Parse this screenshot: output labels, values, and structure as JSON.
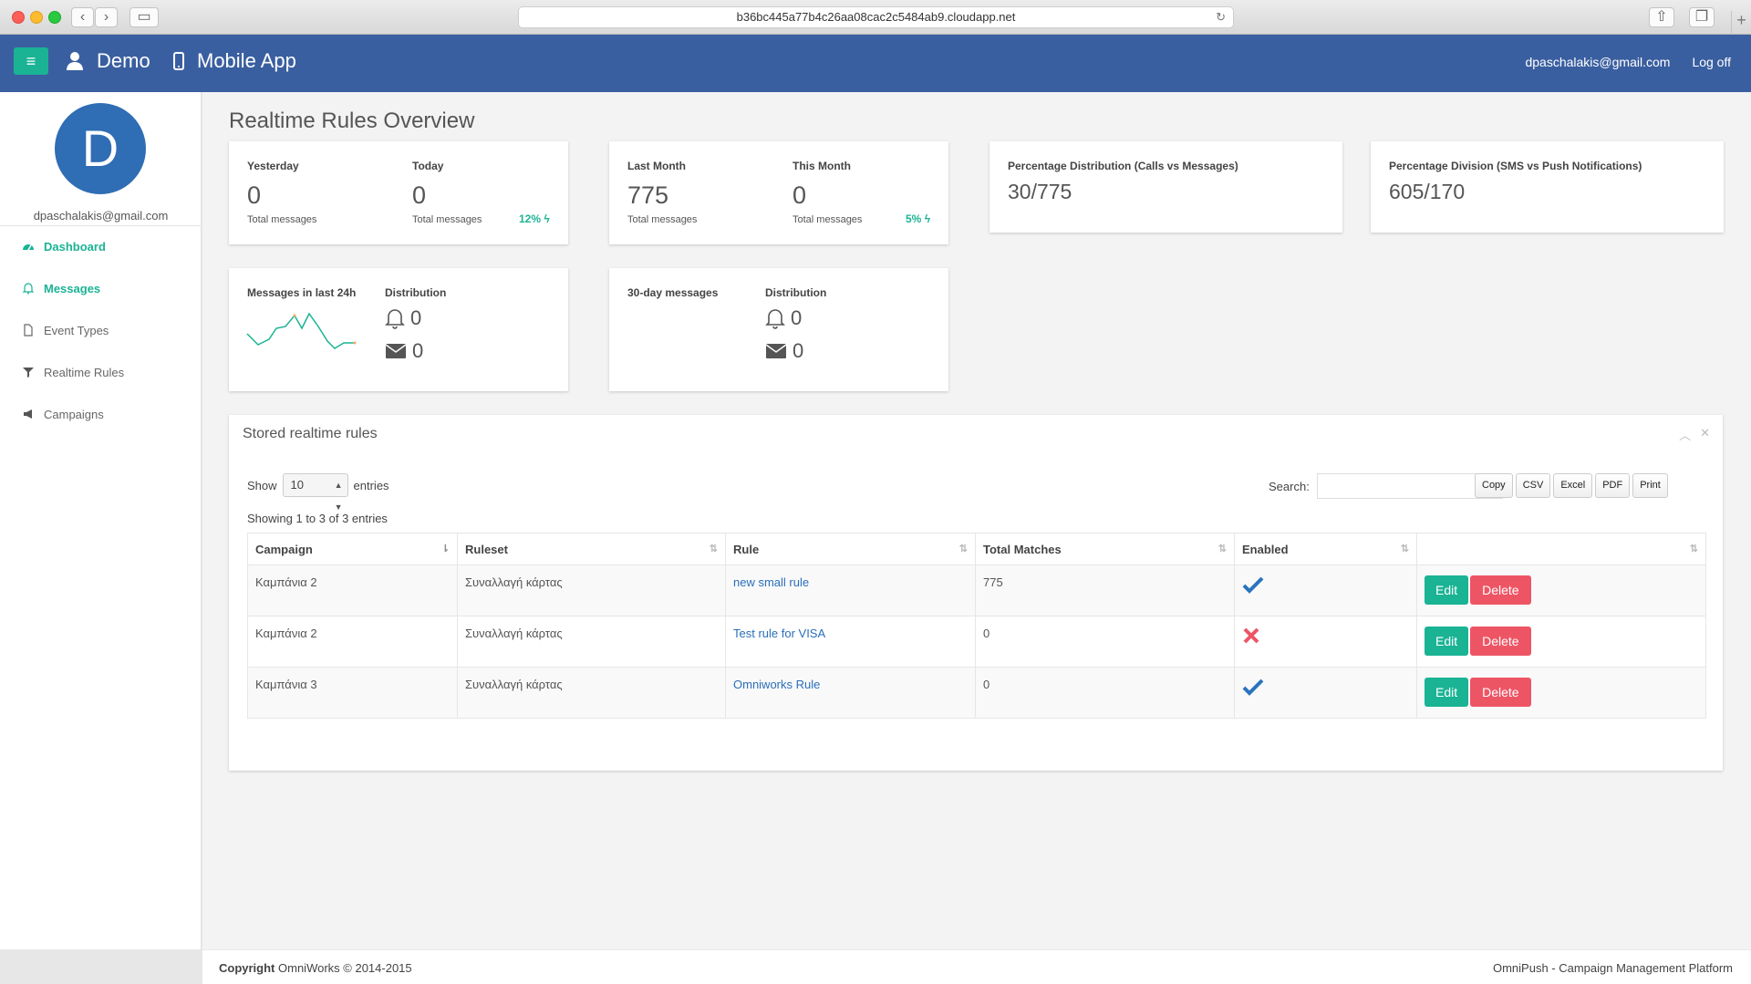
{
  "browser": {
    "url": "b36bc445a77b4c26aa08cac2c5484ab9.cloudapp.net"
  },
  "topbar": {
    "user_label": "Demo",
    "app_label": "Mobile App",
    "email": "dpaschalakis@gmail.com",
    "logoff": "Log off"
  },
  "sidebar": {
    "avatar_letter": "D",
    "email": "dpaschalakis@gmail.com",
    "items": [
      {
        "label": "Dashboard",
        "icon": "dashboard-icon"
      },
      {
        "label": "Messages",
        "icon": "bell-icon"
      },
      {
        "label": "Event Types",
        "icon": "file-icon"
      },
      {
        "label": "Realtime Rules",
        "icon": "filter-icon"
      },
      {
        "label": "Campaigns",
        "icon": "bullhorn-icon"
      }
    ]
  },
  "page": {
    "title": "Realtime Rules Overview"
  },
  "cards": {
    "day": {
      "yesterday_label": "Yesterday",
      "yesterday_value": "0",
      "yesterday_sub": "Total messages",
      "today_label": "Today",
      "today_value": "0",
      "today_sub": "Total messages",
      "pct": "12%"
    },
    "month": {
      "last_label": "Last Month",
      "last_value": "775",
      "last_sub": "Total messages",
      "this_label": "This Month",
      "this_value": "0",
      "this_sub": "Total messages",
      "pct": "5%"
    },
    "pct_dist": {
      "label": "Percentage Distribution (Calls vs Messages)",
      "value": "30/775"
    },
    "pct_div": {
      "label": "Percentage Division (SMS vs Push Notifications)",
      "value": "605/170"
    },
    "last24": {
      "label": "Messages in last 24h",
      "dist_label": "Distribution",
      "bell_value": "0",
      "mail_value": "0"
    },
    "thirty": {
      "label": "30-day messages",
      "dist_label": "Distribution",
      "bell_value": "0",
      "mail_value": "0"
    }
  },
  "panel": {
    "title": "Stored realtime rules",
    "show_label": "Show",
    "show_value": "10",
    "entries_label": "entries",
    "search_label": "Search:",
    "buttons": [
      "Copy",
      "CSV",
      "Excel",
      "PDF",
      "Print"
    ],
    "showing": "Showing 1 to 3 of 3 entries",
    "columns": [
      "Campaign",
      "Ruleset",
      "Rule",
      "Total Matches",
      "Enabled",
      ""
    ],
    "rows": [
      {
        "campaign": "Καμπάνια 2",
        "ruleset": "Συναλλαγή κάρτας",
        "rule": "new small rule",
        "matches": "775",
        "enabled": true
      },
      {
        "campaign": "Καμπάνια 2",
        "ruleset": "Συναλλαγή κάρτας",
        "rule": "Test rule for VISA",
        "matches": "0",
        "enabled": false
      },
      {
        "campaign": "Καμπάνια 3",
        "ruleset": "Συναλλαγή κάρτας",
        "rule": "Omniworks Rule",
        "matches": "0",
        "enabled": true
      }
    ],
    "edit_label": "Edit",
    "delete_label": "Delete"
  },
  "footer": {
    "copyright_bold": "Copyright",
    "copyright_rest": "OmniWorks © 2014-2015",
    "right": "OmniPush - Campaign Management Platform"
  },
  "colors": {
    "topbar": "#3a5fa0",
    "accent": "#1ab394",
    "danger": "#ed5565",
    "link": "#2a6ebb"
  }
}
